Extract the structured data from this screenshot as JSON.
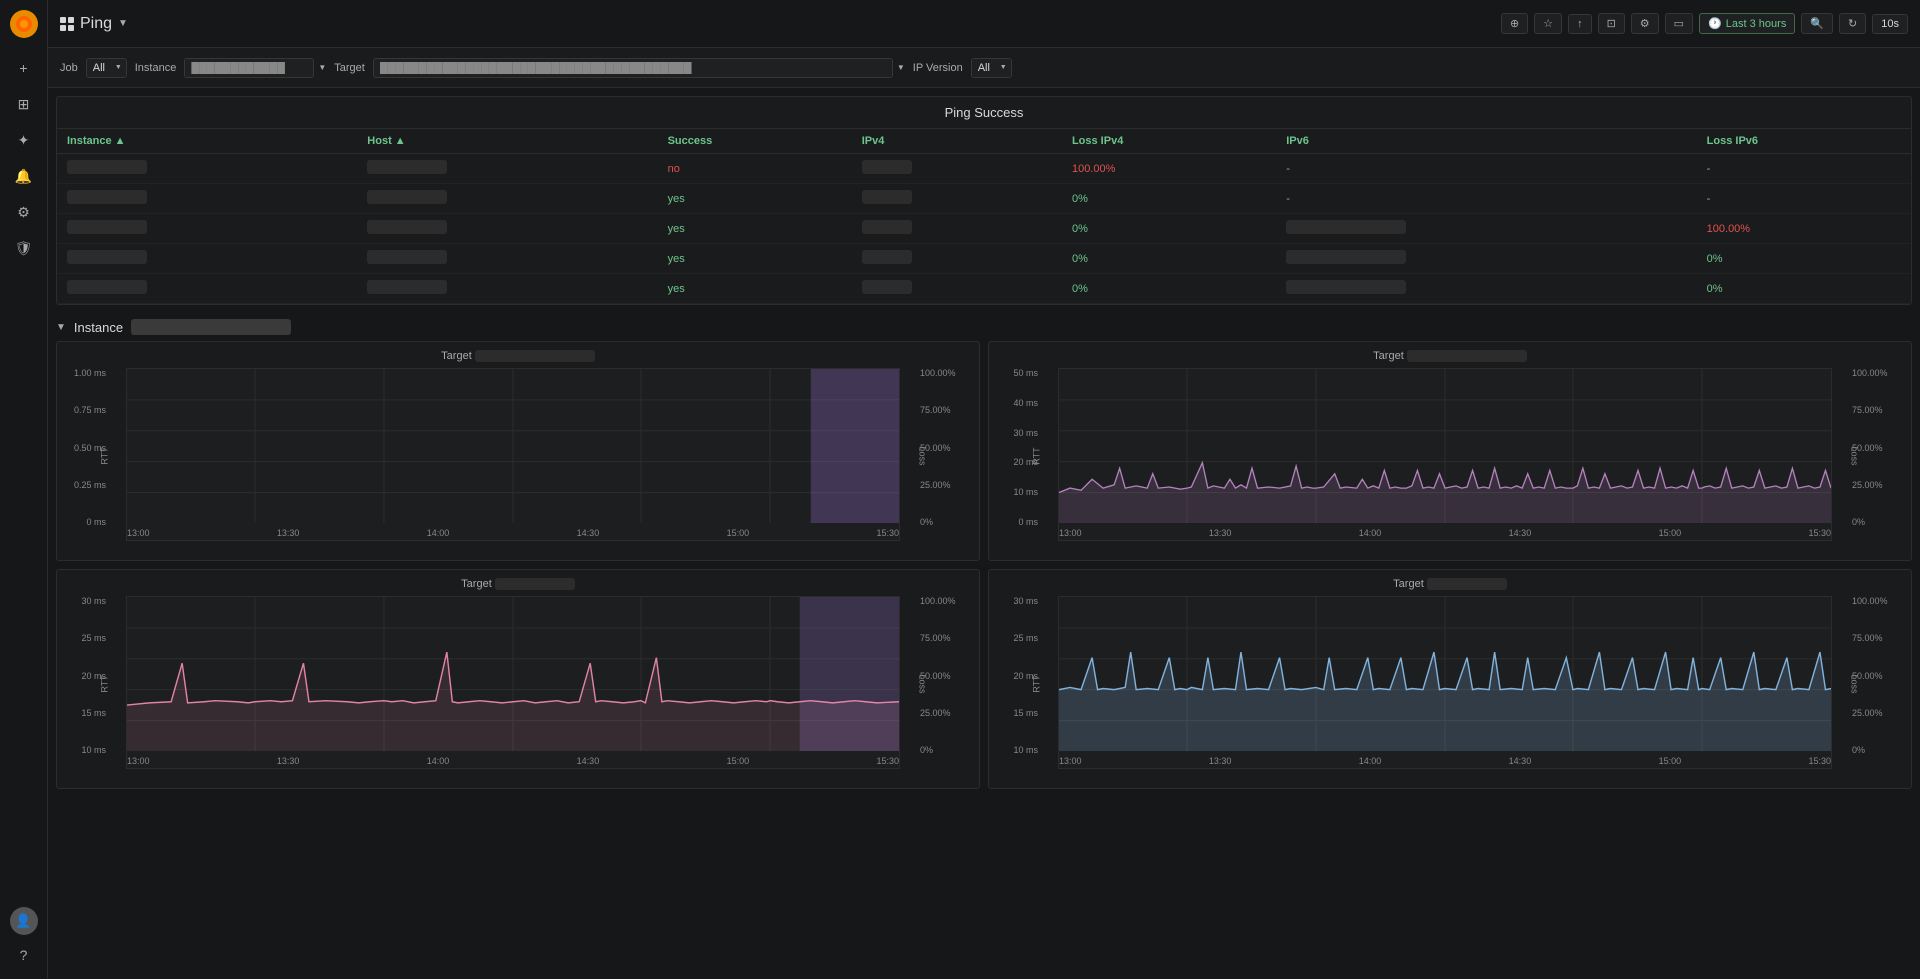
{
  "app": {
    "title": "Ping",
    "logo_icon": "🔥"
  },
  "topbar": {
    "title": "Ping",
    "actions": {
      "add_panel": "⊕",
      "star": "☆",
      "share": "↑",
      "dashboard": "□",
      "settings": "⚙",
      "tv_mode": "⬜",
      "time_range": "Last 3 hours",
      "zoom": "🔍",
      "refresh": "↻",
      "interval": "10s"
    }
  },
  "filters": {
    "job_label": "Job",
    "job_value": "All",
    "instance_label": "Instance",
    "instance_placeholder": "instance filter",
    "target_label": "Target",
    "target_placeholder": "target filter value",
    "ip_version_label": "IP Version",
    "ip_version_value": "All"
  },
  "ping_success": {
    "title": "Ping Success",
    "columns": [
      "Instance",
      "Host",
      "Success",
      "IPv4",
      "Loss IPv4",
      "IPv6",
      "Loss IPv6"
    ],
    "rows": [
      {
        "instance": "blurred-instance-1",
        "host": "blurred-host-1",
        "success": "no",
        "success_type": "error",
        "ipv4": "blurred-ipv4-1",
        "loss_ipv4": "100.00%",
        "loss_ipv4_type": "error",
        "ipv6": "-",
        "loss_ipv6": "-"
      },
      {
        "instance": "blurred-instance-2",
        "host": "blurred-host-2",
        "success": "yes",
        "success_type": "success",
        "ipv4": "blurred-ipv4-2",
        "loss_ipv4": "0%",
        "loss_ipv4_type": "success",
        "ipv6": "-",
        "loss_ipv6": "-"
      },
      {
        "instance": "blurred-instance-3",
        "host": "blurred-host-3",
        "success": "yes",
        "success_type": "success",
        "ipv4": "blurred-ipv4-3",
        "loss_ipv4": "0%",
        "loss_ipv4_type": "success",
        "ipv6": "blurred-ipv6-3",
        "loss_ipv6": "100.00%",
        "loss_ipv6_type": "error"
      },
      {
        "instance": "blurred-instance-4",
        "host": "blurred-host-4",
        "success": "yes",
        "success_type": "success",
        "ipv4": "blurred-ipv4-4",
        "loss_ipv4": "0%",
        "loss_ipv4_type": "success",
        "ipv6": "blurred-ipv6-4",
        "loss_ipv6": "0%",
        "loss_ipv6_type": "success"
      },
      {
        "instance": "blurred-instance-5",
        "host": "blurred-host-5",
        "success": "yes",
        "success_type": "success",
        "ipv4": "blurred-ipv4-5",
        "loss_ipv4": "0%",
        "loss_ipv4_type": "success",
        "ipv6": "blurred-ipv6-5",
        "loss_ipv6": "0%",
        "loss_ipv6_type": "success"
      }
    ]
  },
  "instance_section": {
    "label": "Instance",
    "name_blur": true,
    "charts": [
      {
        "id": "chart1",
        "target_prefix": "Target",
        "has_purple_area": true,
        "y_labels": [
          "1.00 ms",
          "0.75 ms",
          "0.50 ms",
          "0.25 ms",
          "0 ms"
        ],
        "y_right_labels": [
          "100.00%",
          "75.00%",
          "50.00%",
          "25.00%",
          "0%"
        ],
        "x_labels": [
          "13:00",
          "13:30",
          "14:00",
          "14:30",
          "15:00",
          "15:30"
        ],
        "color": "#b39ddb",
        "has_data_left_sparse": true
      },
      {
        "id": "chart2",
        "target_prefix": "Target",
        "has_purple_area": false,
        "y_labels": [
          "50 ms",
          "40 ms",
          "30 ms",
          "20 ms",
          "10 ms",
          "0 ms"
        ],
        "y_right_labels": [
          "100.00%",
          "75.00%",
          "50.00%",
          "25.00%",
          "0%"
        ],
        "x_labels": [
          "13:00",
          "13:30",
          "14:00",
          "14:30",
          "15:00",
          "15:30"
        ],
        "color": "#ce93d8",
        "has_data_full": true
      },
      {
        "id": "chart3",
        "target_prefix": "Target",
        "has_purple_area": true,
        "y_labels": [
          "30 ms",
          "25 ms",
          "20 ms",
          "15 ms",
          "10 ms"
        ],
        "y_right_labels": [
          "100.00%",
          "75.00%",
          "50.00%",
          "25.00%",
          "0%"
        ],
        "x_labels": [
          "13:00",
          "13:30",
          "14:00",
          "14:30",
          "15:00",
          "15:30"
        ],
        "color": "#f48fb1",
        "has_data_spiky": true
      },
      {
        "id": "chart4",
        "target_prefix": "Target",
        "has_purple_area": false,
        "y_labels": [
          "30 ms",
          "25 ms",
          "20 ms",
          "15 ms",
          "10 ms"
        ],
        "y_right_labels": [
          "100.00%",
          "75.00%",
          "50.00%",
          "25.00%",
          "0%"
        ],
        "x_labels": [
          "13:00",
          "13:30",
          "14:00",
          "14:30",
          "15:00",
          "15:30"
        ],
        "color": "#90caf9",
        "has_data_spiky2": true
      }
    ]
  },
  "sidebar": {
    "icons": [
      {
        "name": "plus-icon",
        "symbol": "+",
        "label": "Add"
      },
      {
        "name": "dashboard-icon",
        "symbol": "⊞",
        "label": "Dashboard"
      },
      {
        "name": "explore-icon",
        "symbol": "✦",
        "label": "Explore"
      },
      {
        "name": "bell-icon",
        "symbol": "🔔",
        "label": "Alerts"
      },
      {
        "name": "gear-icon",
        "symbol": "⚙",
        "label": "Settings"
      },
      {
        "name": "shield-icon",
        "symbol": "🛡",
        "label": "Admin"
      }
    ]
  }
}
